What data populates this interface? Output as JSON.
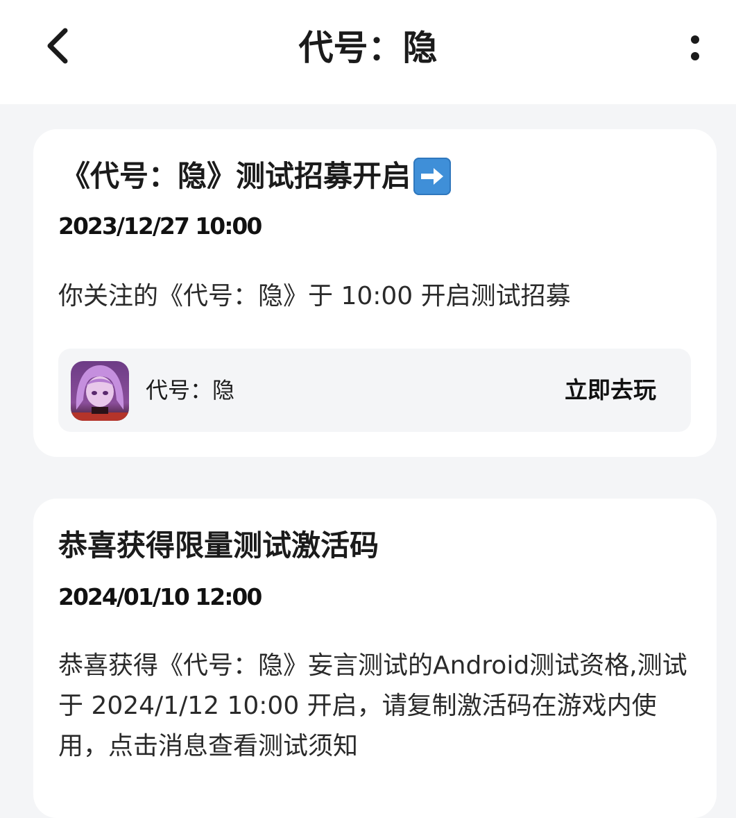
{
  "header": {
    "title": "代号：隐",
    "back_icon": "chevron-left-icon",
    "more_icon": "more-vertical-icon"
  },
  "messages": [
    {
      "title": "《代号：隐》测试招募开启",
      "title_emoji": "arrow-right-emoji",
      "time": "2023/12/27 10:00",
      "body": "你关注的《代号：隐》于 10:00 开启测试招募",
      "game": {
        "name": "代号：隐",
        "action_label": "立即去玩"
      }
    },
    {
      "title": "恭喜获得限量测试激活码",
      "time": "2024/01/10 12:00",
      "body": "恭喜获得《代号：隐》妄言测试的Android测试资格,测试于 2024/1/12 10:00 开启，请复制激活码在游戏内使用，点击消息查看测试须知"
    }
  ],
  "colors": {
    "background": "#f4f5f7",
    "card": "#ffffff",
    "text": "#1b1b1b",
    "emoji_blue": "#3f8fd8"
  }
}
